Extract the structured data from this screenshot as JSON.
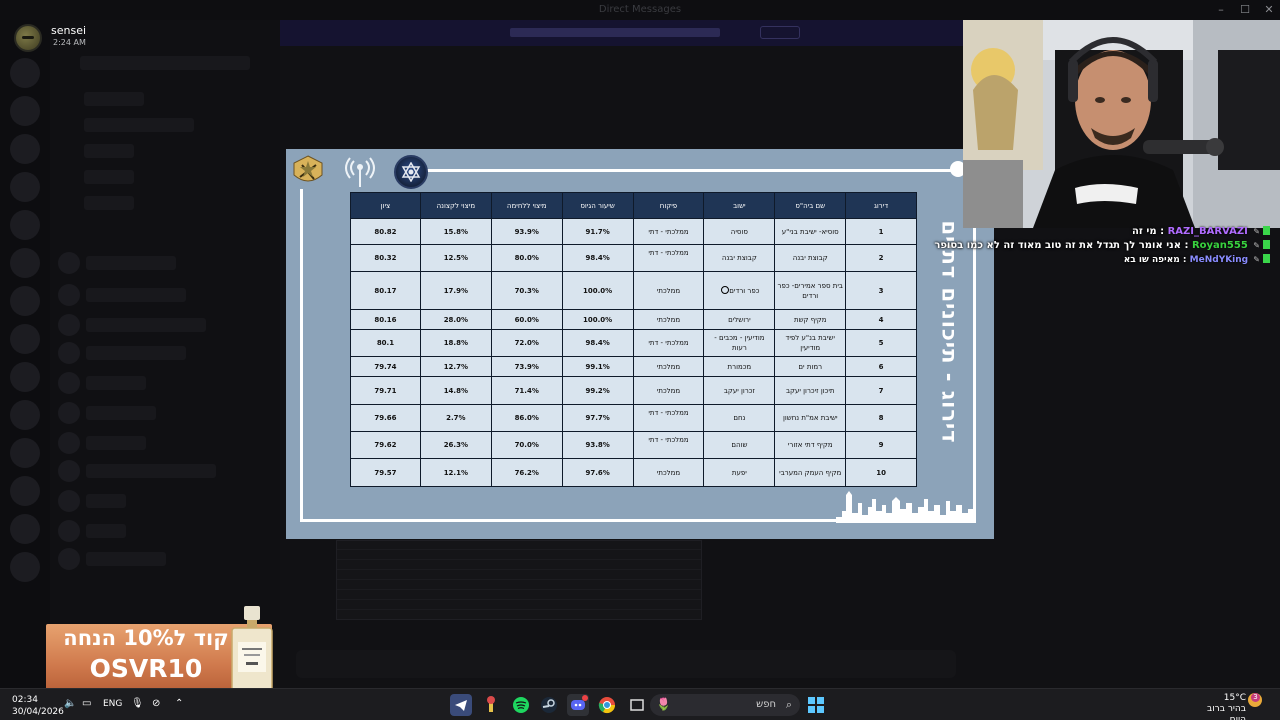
{
  "window": {
    "title": "Direct Messages"
  },
  "account": {
    "name": "sensei",
    "time": "2:24 AM"
  },
  "slide": {
    "title": "דירוג - תיכונים דתיים",
    "headers": [
      "דירוג",
      "שם ביה\"ס",
      "ישוב",
      "פיקוח",
      "שיעור הגיוס",
      "מיצוי ללחימה",
      "מיצוי לקצונה",
      "ציון"
    ],
    "rows": [
      {
        "rank": "1",
        "school": "סוסיא- ישיבת בני\"ע",
        "town": "סוסיה",
        "supervision": "ממלכתי - דתי",
        "enlist": "91.7%",
        "combat": "93.9%",
        "officer": "15.8%",
        "score": "80.82"
      },
      {
        "rank": "2",
        "school": "קבוצת יבנה",
        "town": "קבוצת יבנה",
        "supervision": "ממלכתי - דתי",
        "enlist": "98.4%",
        "combat": "80.0%",
        "officer": "12.5%",
        "score": "80.32"
      },
      {
        "rank": "3",
        "school": "בית ספר אמירים- כפר ורדים",
        "town": "כפר ורדים",
        "supervision": "ממלכתי",
        "enlist": "100.0%",
        "combat": "70.3%",
        "officer": "17.9%",
        "score": "80.17"
      },
      {
        "rank": "4",
        "school": "מקיף קשת",
        "town": "ירושלים",
        "supervision": "ממלכתי",
        "enlist": "100.0%",
        "combat": "60.0%",
        "officer": "28.0%",
        "score": "80.16"
      },
      {
        "rank": "5",
        "school": "ישיבת בנ\"ע לפיד מודיעין",
        "town": "מודיעין - מכבים - רעות",
        "supervision": "ממלכתי - דתי",
        "enlist": "98.4%",
        "combat": "72.0%",
        "officer": "18.8%",
        "score": "80.1"
      },
      {
        "rank": "6",
        "school": "רמות ים",
        "town": "מכמורת",
        "supervision": "ממלכתי",
        "enlist": "99.1%",
        "combat": "73.9%",
        "officer": "12.7%",
        "score": "79.74"
      },
      {
        "rank": "7",
        "school": "תיכון זיכרון יעקב",
        "town": "זכרון יעקב",
        "supervision": "ממלכתי",
        "enlist": "99.2%",
        "combat": "71.4%",
        "officer": "14.8%",
        "score": "79.71"
      },
      {
        "rank": "8",
        "school": "ישיבת אמ\"ת נחשון",
        "town": "נחם",
        "supervision": "ממלכתי - דתי",
        "enlist": "97.7%",
        "combat": "86.0%",
        "officer": "2.7%",
        "score": "79.66"
      },
      {
        "rank": "9",
        "school": "מקיף דתי אזורי",
        "town": "שוהם",
        "supervision": "ממלכתי - דתי",
        "enlist": "93.8%",
        "combat": "70.0%",
        "officer": "26.3%",
        "score": "79.62"
      },
      {
        "rank": "10",
        "school": "מקיף העמק המערבי",
        "town": "יפעת",
        "supervision": "ממלכתי",
        "enlist": "97.6%",
        "combat": "76.2%",
        "officer": "12.1%",
        "score": "79.57"
      }
    ]
  },
  "chat": [
    {
      "user": "RAZI_BARVAZI",
      "user_color": "#b06cff",
      "text": "מי זה"
    },
    {
      "user": "Royan555",
      "user_color": "#39d23f",
      "text": "אני אומר לך תגדל את זה טוב מאוד זה לא כמו בסופר"
    },
    {
      "user": "MeNdYKing",
      "user_color": "#8a8cff",
      "text": "מאיפה שו בא"
    }
  ],
  "promo": {
    "line1": "קוד ל10% הנחה",
    "line2": "OSVR10"
  },
  "taskbar": {
    "time": "02:34",
    "date": "30/04/2026",
    "lang": "ENG",
    "search_placeholder": "חפש",
    "weather_temp": "15°C",
    "weather_desc": "בהיר ברוב היום",
    "weather_badge": "3"
  }
}
